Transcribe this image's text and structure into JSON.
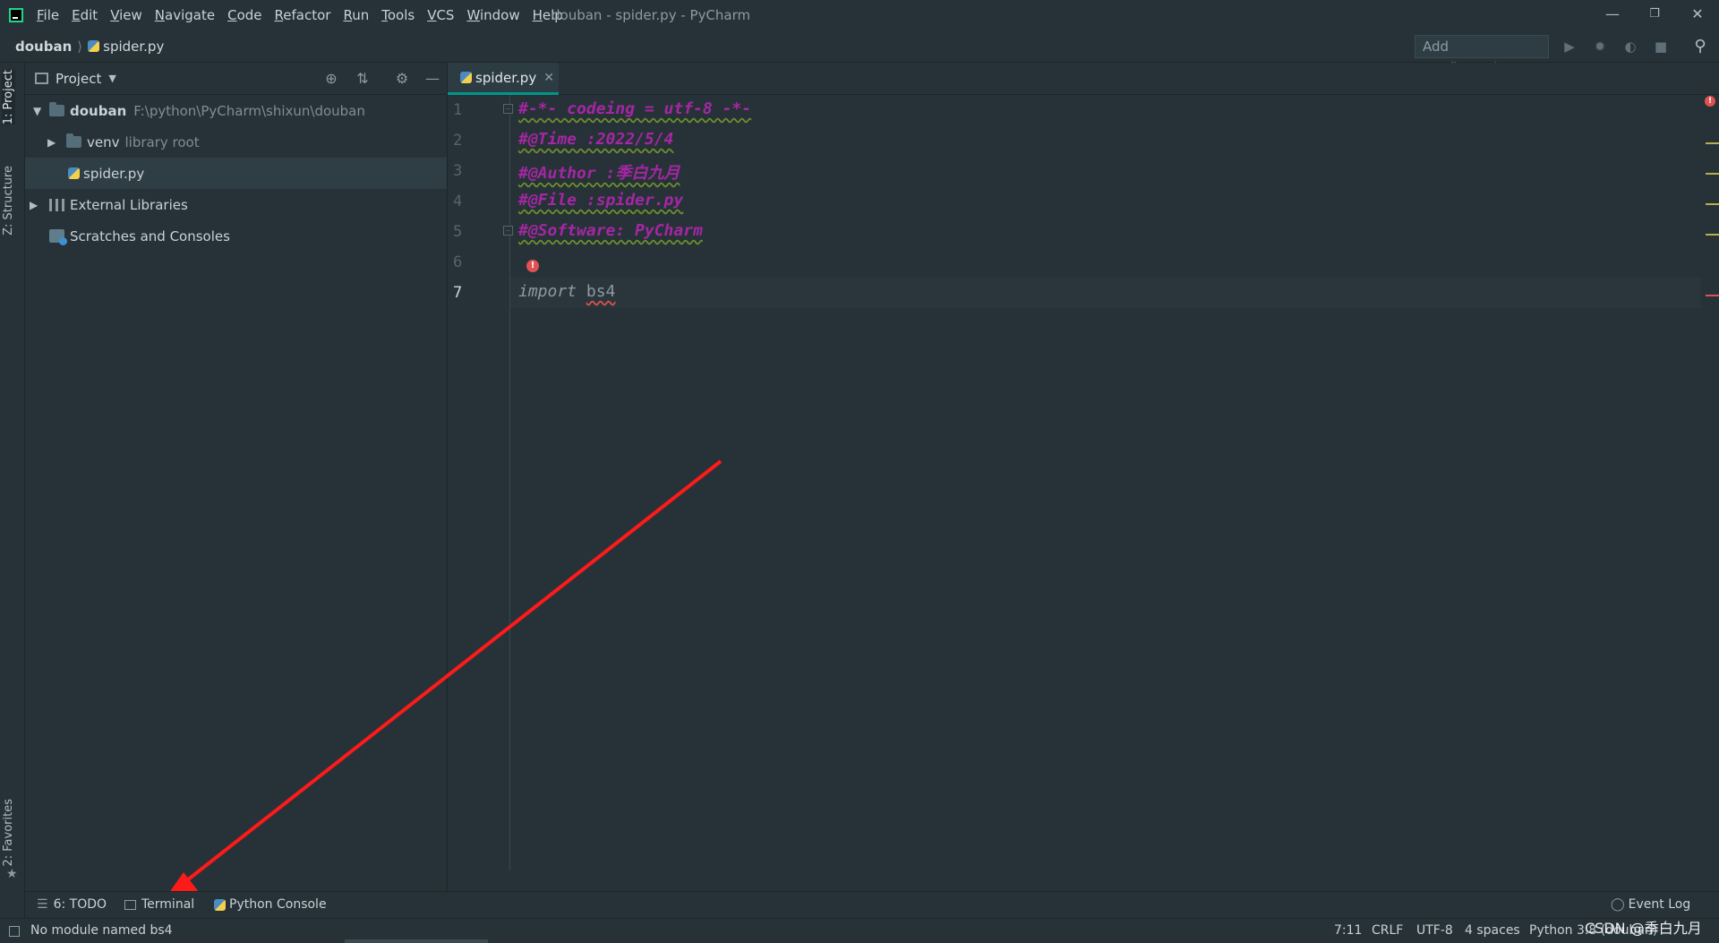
{
  "window": {
    "title": "douban - spider.py - PyCharm",
    "menu": [
      "File",
      "Edit",
      "View",
      "Navigate",
      "Code",
      "Refactor",
      "Run",
      "Tools",
      "VCS",
      "Window",
      "Help"
    ]
  },
  "navbar": {
    "project": "douban",
    "file": "spider.py",
    "add_configuration": "Add Configuration..."
  },
  "side_tabs": {
    "project": "1: Project",
    "structure": "Z: Structure",
    "favorites": "2: Favorites"
  },
  "project_panel": {
    "title": "Project",
    "tree": [
      {
        "name": "douban",
        "path": "F:\\python\\PyCharm\\shixun\\douban"
      },
      {
        "name": "venv",
        "note": "library root"
      },
      {
        "name": "spider.py"
      },
      {
        "name": "External Libraries"
      },
      {
        "name": "Scratches and Consoles"
      }
    ]
  },
  "editor": {
    "tab": "spider.py",
    "line_numbers": [
      "1",
      "2",
      "3",
      "4",
      "5",
      "6",
      "7"
    ],
    "lines": [
      "#-*- codeing = utf-8 -*-",
      "#@Time :2022/5/4",
      "#@Author :季白九月",
      "#@File :spider.py",
      "#@Software: PyCharm",
      "",
      ""
    ],
    "import_keyword": "import",
    "import_module": "bs4"
  },
  "bottom_tools": {
    "todo": "6: TODO",
    "terminal": "Terminal",
    "python_console": "Python Console",
    "event_log": "Event Log"
  },
  "status": {
    "message": "No module named bs4",
    "position": "7:11",
    "line_sep": "CRLF",
    "encoding": "UTF-8",
    "indent": "4 spaces",
    "interpreter": "Python 3.8 (douban)",
    "watermark": "CSDN @季白九月"
  },
  "colors": {
    "background": "#263238",
    "comment": "#a626a4",
    "accent": "#009688",
    "error": "#e05252"
  }
}
